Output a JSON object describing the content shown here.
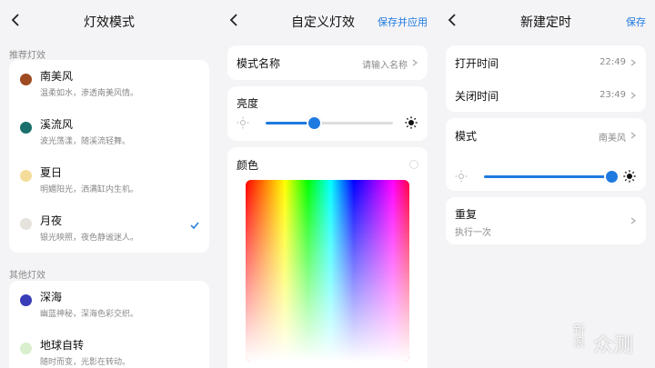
{
  "panel1": {
    "title": "灯效模式",
    "recommended_label": "推荐灯效",
    "other_label": "其他灯效",
    "recommended": [
      {
        "name": "南美风",
        "desc": "温柔如水，渗透南美风情。",
        "color": "#9e4a22",
        "selected": false
      },
      {
        "name": "溪流风",
        "desc": "波光荡漾，随溪流轻舞。",
        "color": "#1b6f6b",
        "selected": false
      },
      {
        "name": "夏日",
        "desc": "明媚阳光，洒满缸内生机。",
        "color": "#f4dc9a",
        "selected": false
      },
      {
        "name": "月夜",
        "desc": "银光映照，夜色静谧迷人。",
        "color": "#e6e3dc",
        "selected": true
      }
    ],
    "other": [
      {
        "name": "深海",
        "desc": "幽蓝神秘，深海色彩交织。",
        "color": "#3a3db8"
      },
      {
        "name": "地球自转",
        "desc": "随时而变，光影在转动。",
        "color": "#d9efcd"
      }
    ]
  },
  "panel2": {
    "title": "自定义灯效",
    "action": "保存并应用",
    "mode_name_label": "模式名称",
    "mode_name_placeholder": "请输入名称",
    "brightness_label": "亮度",
    "brightness_percent": 38,
    "color_label": "颜色"
  },
  "panel3": {
    "title": "新建定时",
    "action": "保存",
    "on_time_label": "打开时间",
    "on_time_value": "22:49",
    "off_time_label": "关闭时间",
    "off_time_value": "23:49",
    "mode_label": "模式",
    "mode_value": "南美风",
    "brightness_percent": 100,
    "repeat_label": "重复",
    "repeat_value": "执行一次"
  },
  "watermark": {
    "line1": "新",
    "line2": "浪",
    "text": "众测"
  },
  "colors": {
    "accent": "#1f7ae0",
    "background": "#f4f4f6",
    "card": "#ffffff"
  }
}
